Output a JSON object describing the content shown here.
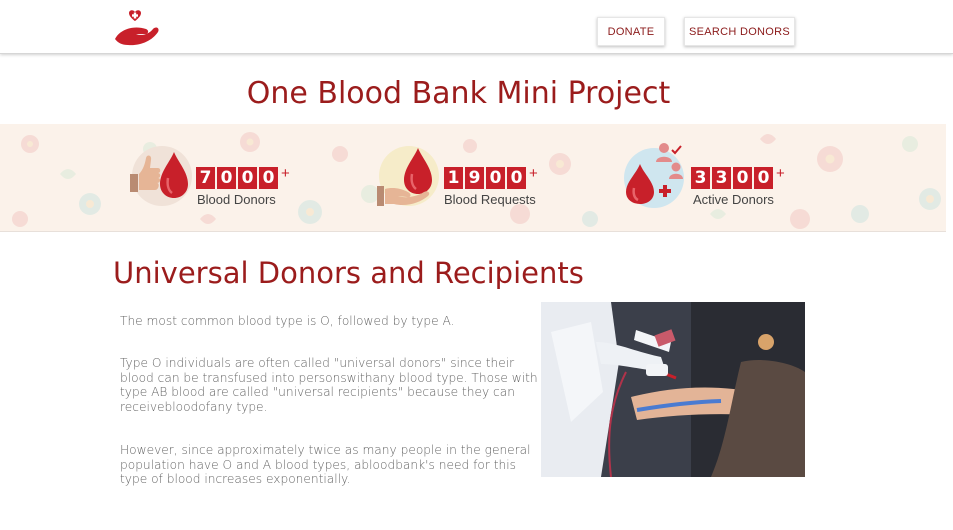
{
  "navbar": {
    "logo_icon": "heart-hand-icon",
    "donate_label": "DONATE",
    "search_label": "SEARCH DONORS",
    "accent_color": "#8b1a1a"
  },
  "page_title": "One Blood Bank Mini Project",
  "stats": [
    {
      "icon": "thumbs-up-blood-drop-icon",
      "digits": [
        "7",
        "0",
        "0",
        "0"
      ],
      "suffix": "+",
      "label": "Blood Donors"
    },
    {
      "icon": "hand-blood-drop-icon",
      "digits": [
        "1",
        "9",
        "0",
        "0"
      ],
      "suffix": "+",
      "label": "Blood Requests"
    },
    {
      "icon": "donors-blood-drop-icon",
      "digits": [
        "3",
        "3",
        "0",
        "0"
      ],
      "suffix": "+",
      "label": "Active Donors"
    }
  ],
  "section": {
    "title": "Universal Donors and Recipients",
    "paragraphs": [
      "The most common blood type is O, followed by type A.",
      "Type O individuals are often called \"universal donors\" since their blood can be transfused into personswithany blood type. Those with type AB blood are called \"universal recipients\" because they can receivebloodofany type.",
      "However, since approximately twice as many people in the general population have O and A blood types, abloodbank's need for this type of blood increases exponentially."
    ],
    "photo": "blood-donation-photo"
  },
  "colors": {
    "brand_red": "#9b1c1c",
    "digit_red": "#c8202a",
    "band_bg": "#fbf2ea"
  }
}
